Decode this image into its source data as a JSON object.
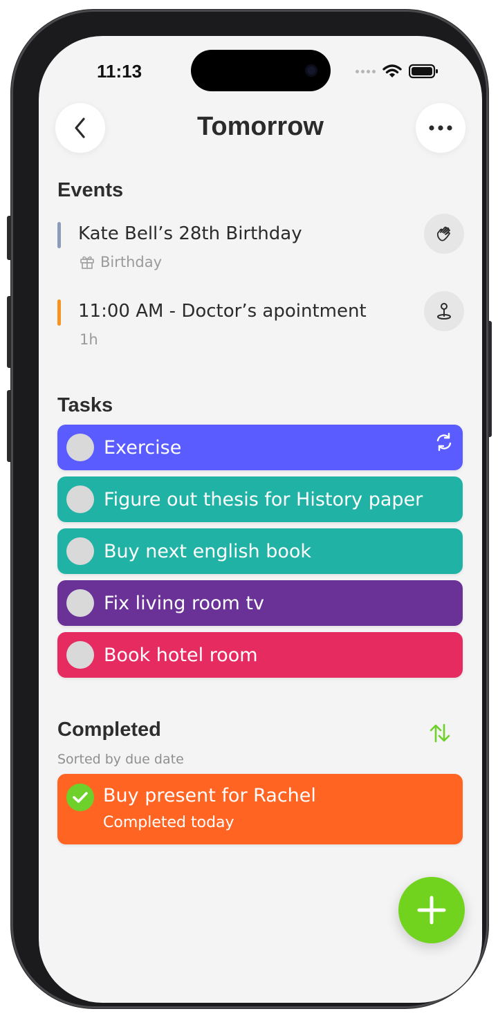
{
  "status_bar": {
    "time": "11:13"
  },
  "header": {
    "title": "Tomorrow",
    "back_icon": "chevron-left-icon",
    "more_icon": "ellipsis-icon"
  },
  "events": {
    "heading": "Events",
    "items": [
      {
        "title": "Kate Bell’s 28th Birthday",
        "subtitle": "Birthday",
        "subtitle_icon": "gift-icon",
        "action_icon": "waving-hand-icon",
        "bar_color": "#8c9bb8"
      },
      {
        "title": "11:00 AM - Doctor’s apointment",
        "subtitle": "1h",
        "action_icon": "map-pin-icon",
        "bar_color": "#f7931e"
      }
    ]
  },
  "tasks": {
    "heading": "Tasks",
    "items": [
      {
        "label": "Exercise",
        "color": "#5a5cff",
        "repeat_icon": "repeat-icon"
      },
      {
        "label": "Figure out thesis for History paper",
        "color": "#20b3a5"
      },
      {
        "label": "Buy next english book",
        "color": "#20b3a5"
      },
      {
        "label": "Fix living room tv",
        "color": "#6a3197"
      },
      {
        "label": "Book hotel room",
        "color": "#e62b61"
      }
    ]
  },
  "completed": {
    "heading": "Completed",
    "sort_note": "Sorted by due date",
    "sort_icon": "sort-arrows-icon",
    "items": [
      {
        "title": "Buy present for Rachel",
        "subtitle": "Completed today",
        "color": "#ff6423"
      }
    ]
  },
  "fab": {
    "icon": "plus-icon",
    "color": "#72d31e"
  },
  "colors": {
    "accent_green": "#72d31e",
    "check_green": "#6ed02a"
  }
}
